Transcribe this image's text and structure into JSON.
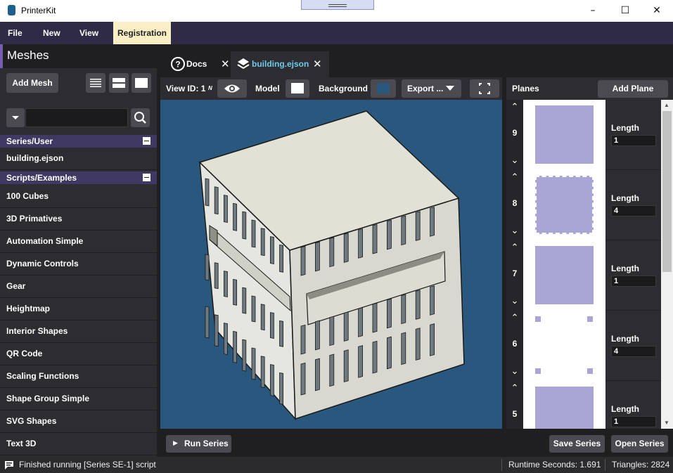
{
  "window": {
    "title": "PrinterKit"
  },
  "menu": {
    "file": "File",
    "new": "New",
    "view": "View",
    "registration": "Registration"
  },
  "sidebar": {
    "header": "Meshes",
    "add_mesh": "Add Mesh",
    "search_value": "",
    "groups": [
      {
        "label": "Series/User",
        "items": [
          "building.ejson"
        ]
      },
      {
        "label": "Scripts/Examples",
        "items": [
          "100 Cubes",
          "3D Primatives",
          "Automation Simple",
          "Dynamic Controls",
          "Gear",
          "Heightmap",
          "Interior Shapes",
          "QR Code",
          "Scaling Functions",
          "Shape Group Simple",
          "SVG Shapes",
          "Text 3D"
        ]
      }
    ]
  },
  "tabs": [
    {
      "label": "Docs",
      "icon": "help-circle-icon"
    },
    {
      "label": "building.ejson",
      "icon": "layers-icon",
      "active": true
    }
  ],
  "viewer": {
    "view_id_label": "View ID: 1",
    "view_id_suffix": "N",
    "model_label": "Model",
    "model_color": "#ffffff",
    "background_label": "Background",
    "background_color": "#29577d",
    "export_label": "Export ..."
  },
  "planes": {
    "header": "Planes",
    "add_label": "Add Plane",
    "length_label": "Length",
    "rows": [
      {
        "index": "9",
        "length": "1",
        "style": "solid"
      },
      {
        "index": "8",
        "length": "4",
        "style": "dashed"
      },
      {
        "index": "7",
        "length": "1",
        "style": "solid"
      },
      {
        "index": "6",
        "length": "4",
        "style": "corners"
      },
      {
        "index": "5",
        "length": "1",
        "style": "solid"
      }
    ]
  },
  "bottom": {
    "run": "Run Series",
    "save": "Save Series",
    "open": "Open Series"
  },
  "status": {
    "message": "Finished running [Series SE-1] script",
    "runtime": "Runtime Seconds: 1.691",
    "triangles": "Triangles: 2824"
  },
  "colors": {
    "accent": "#6ec9ea",
    "plane_fill": "#a9a6d6",
    "group_header": "#403963",
    "menubar": "#2f2a45"
  }
}
